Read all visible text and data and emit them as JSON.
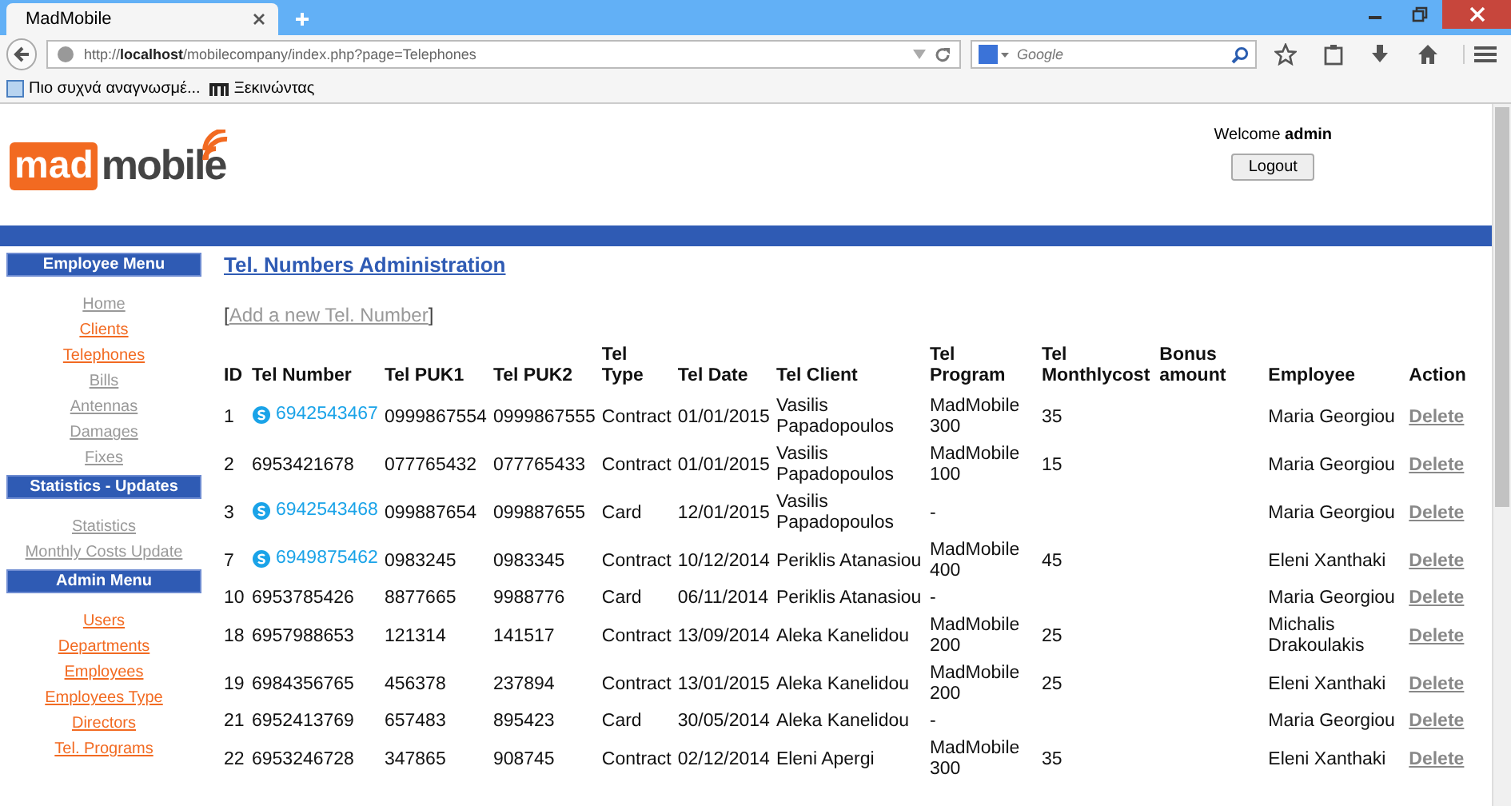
{
  "browser": {
    "tab_title": "MadMobile",
    "url_scheme": "http://",
    "url_host": "localhost",
    "url_path": "/mobilecompany/index.php?page=Telephones",
    "search_placeholder": "Google",
    "bookmarks": [
      {
        "kind": "folder",
        "label": "Πιο συχνά αναγνωσμέ..."
      },
      {
        "kind": "site",
        "label": "Ξεκινώντας"
      }
    ]
  },
  "header": {
    "logo_left": "mad",
    "logo_right": "mobile",
    "welcome": "Welcome",
    "user": "admin",
    "logout": "Logout"
  },
  "sidebar": [
    {
      "title": "Employee Menu",
      "items": [
        {
          "label": "Home",
          "visited": true
        },
        {
          "label": "Clients",
          "visited": false
        },
        {
          "label": "Telephones",
          "visited": false
        },
        {
          "label": "Bills",
          "visited": true
        },
        {
          "label": "Antennas",
          "visited": true
        },
        {
          "label": "Damages",
          "visited": true
        },
        {
          "label": "Fixes",
          "visited": true
        }
      ]
    },
    {
      "title": "Statistics - Updates",
      "items": [
        {
          "label": "Statistics",
          "visited": true
        },
        {
          "label": "Monthly Costs Update",
          "visited": true
        }
      ]
    },
    {
      "title": "Admin Menu",
      "items": [
        {
          "label": "Users",
          "visited": false
        },
        {
          "label": "Departments",
          "visited": false
        },
        {
          "label": "Employees",
          "visited": false
        },
        {
          "label": "Employees Type",
          "visited": false
        },
        {
          "label": "Directors",
          "visited": false
        },
        {
          "label": "Tel. Programs",
          "visited": false
        }
      ]
    }
  ],
  "main": {
    "title": "Tel. Numbers Administration",
    "add_open": "[",
    "add_link": "Add a new Tel. Number",
    "add_close": "]",
    "table": {
      "columns": [
        "ID",
        "Tel Number",
        "Tel PUK1",
        "Tel PUK2",
        "Tel Type",
        "Tel Date",
        "Tel Client",
        "Tel Program",
        "Tel Monthlycost",
        "Bonus amount",
        "Employee",
        "Action"
      ],
      "rows": [
        {
          "id": "1",
          "skype": true,
          "number": "6942543467",
          "puk1": "0999867554",
          "puk2": "0999867555",
          "type": "Contract",
          "date": "01/01/2015",
          "client": "Vasilis Papadopoulos",
          "program": "MadMobile 300",
          "cost": "35",
          "employee": "Maria Georgiou",
          "action": "Delete"
        },
        {
          "id": "2",
          "skype": false,
          "number": "6953421678",
          "puk1": "077765432",
          "puk2": "077765433",
          "type": "Contract",
          "date": "01/01/2015",
          "client": "Vasilis Papadopoulos",
          "program": "MadMobile 100",
          "cost": "15",
          "employee": "Maria Georgiou",
          "action": "Delete"
        },
        {
          "id": "3",
          "skype": true,
          "number": "6942543468",
          "puk1": "099887654",
          "puk2": "099887655",
          "type": "Card",
          "date": "12/01/2015",
          "client": "Vasilis Papadopoulos",
          "program": "-",
          "cost": "",
          "employee": "Maria Georgiou",
          "action": "Delete"
        },
        {
          "id": "7",
          "skype": true,
          "number": "6949875462",
          "puk1": "0983245",
          "puk2": "0983345",
          "type": "Contract",
          "date": "10/12/2014",
          "client": "Periklis Atanasiou",
          "program": "MadMobile 400",
          "cost": "45",
          "employee": "Eleni Xanthaki",
          "action": "Delete"
        },
        {
          "id": "10",
          "skype": false,
          "number": "6953785426",
          "puk1": "8877665",
          "puk2": "9988776",
          "type": "Card",
          "date": "06/11/2014",
          "client": "Periklis Atanasiou",
          "program": "-",
          "cost": "",
          "employee": "Maria Georgiou",
          "action": "Delete"
        },
        {
          "id": "18",
          "skype": false,
          "number": "6957988653",
          "puk1": "121314",
          "puk2": "141517",
          "type": "Contract",
          "date": "13/09/2014",
          "client": "Aleka Kanelidou",
          "program": "MadMobile 200",
          "cost": "25",
          "employee": "Michalis Drakoulakis",
          "action": "Delete"
        },
        {
          "id": "19",
          "skype": false,
          "number": "6984356765",
          "puk1": "456378",
          "puk2": "237894",
          "type": "Contract",
          "date": "13/01/2015",
          "client": "Aleka Kanelidou",
          "program": "MadMobile 200",
          "cost": "25",
          "employee": "Eleni Xanthaki",
          "action": "Delete"
        },
        {
          "id": "21",
          "skype": false,
          "number": "6952413769",
          "puk1": "657483",
          "puk2": "895423",
          "type": "Card",
          "date": "30/05/2014",
          "client": "Aleka Kanelidou",
          "program": "-",
          "cost": "",
          "employee": "Maria Georgiou",
          "action": "Delete"
        },
        {
          "id": "22",
          "skype": false,
          "number": "6953246728",
          "puk1": "347865",
          "puk2": "908745",
          "type": "Contract",
          "date": "02/12/2014",
          "client": "Eleni Apergi",
          "program": "MadMobile 300",
          "cost": "35",
          "employee": "Eleni Xanthaki",
          "action": "Delete"
        }
      ]
    }
  }
}
